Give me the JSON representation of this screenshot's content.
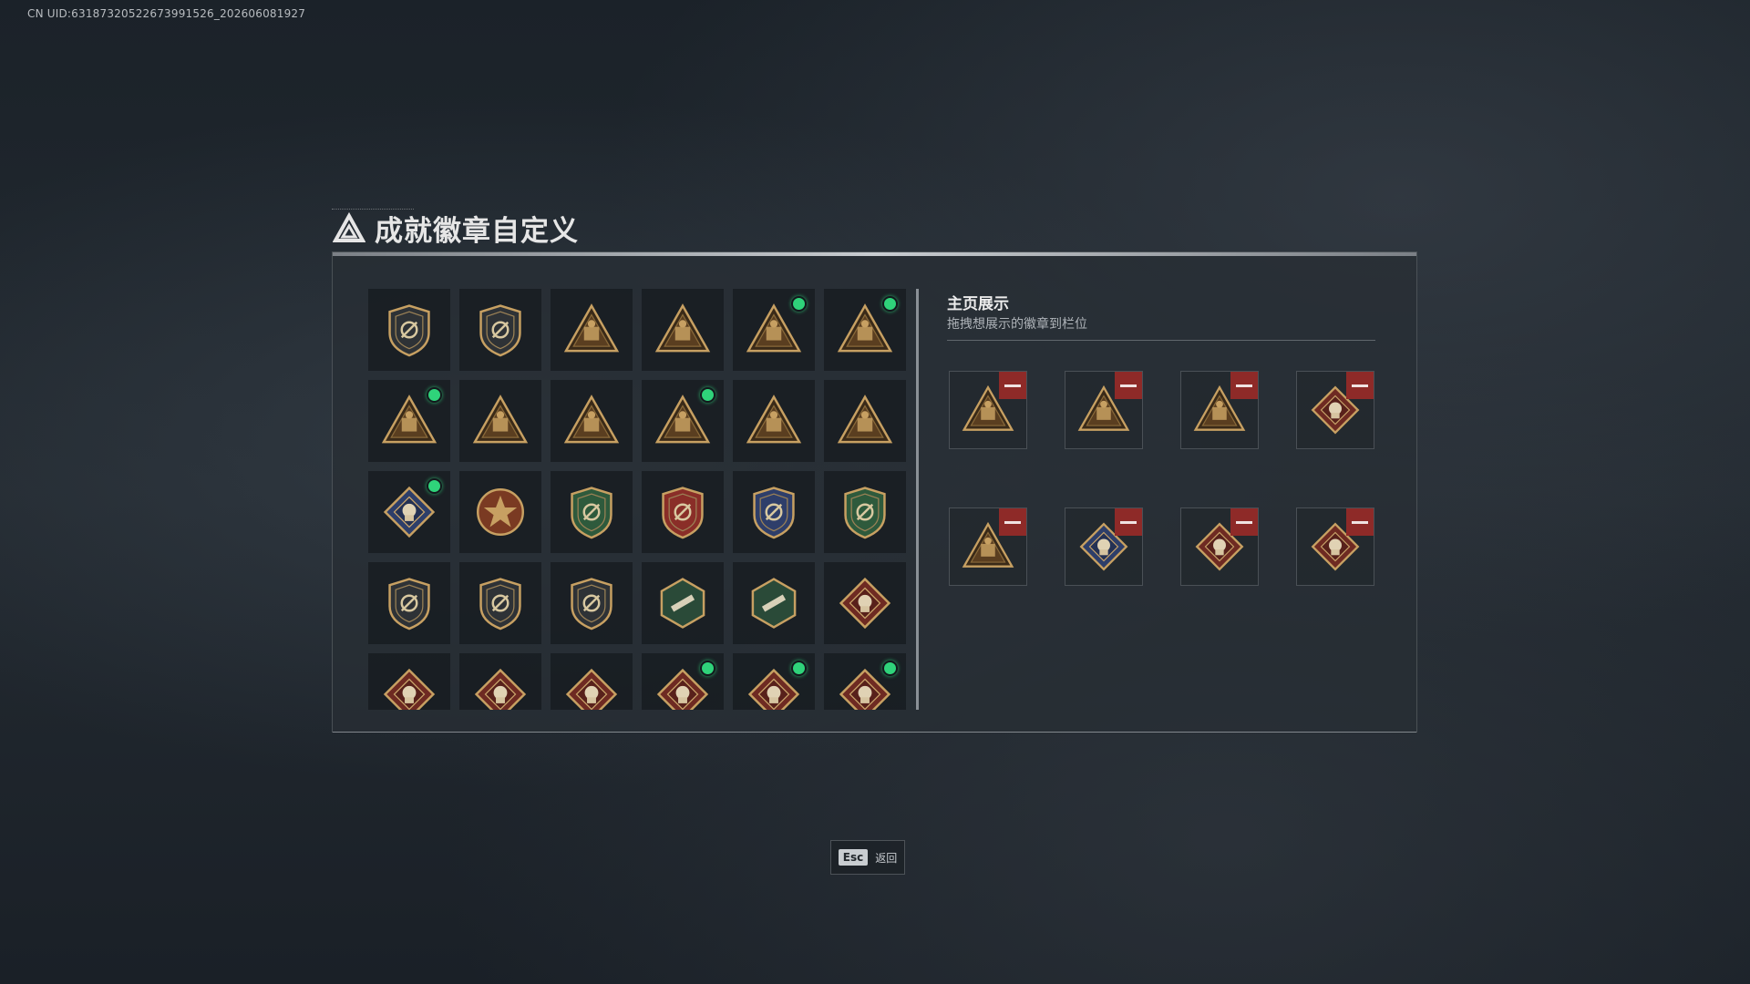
{
  "uid_text": "CN UID:6318732052267399​1526_202606081927",
  "title": "成就徽章自定义",
  "showcase": {
    "title": "主页展示",
    "subtitle": "拖拽想展示的徽章到栏位"
  },
  "esc": {
    "key": "Esc",
    "label": "返回"
  },
  "colors": {
    "new_dot": "#2fd37a",
    "remove": "#8e2a28",
    "gold": "#c7a062",
    "dark_red": "#6e2a22"
  },
  "badges": [
    {
      "id": "b1",
      "icon": "shield-delta-icon",
      "new": false
    },
    {
      "id": "b2",
      "icon": "shield-helicopter-icon",
      "new": false
    },
    {
      "id": "b3",
      "icon": "triangle-map-icon",
      "new": false
    },
    {
      "id": "b4",
      "icon": "triangle-bag-55-icon",
      "new": false
    },
    {
      "id": "b5",
      "icon": "triangle-gate-icon",
      "new": true
    },
    {
      "id": "b6",
      "icon": "triangle-58-icon",
      "new": true
    },
    {
      "id": "b7",
      "icon": "triangle-winged-icon",
      "new": true
    },
    {
      "id": "b8",
      "icon": "triangle-hands-icon",
      "new": false
    },
    {
      "id": "b9",
      "icon": "triangle-number-1-icon",
      "new": false
    },
    {
      "id": "b10",
      "icon": "triangle-crate-icon",
      "new": true
    },
    {
      "id": "b11",
      "icon": "triangle-beast-icon",
      "new": false
    },
    {
      "id": "b12",
      "icon": "triangle-soldiers-icon",
      "new": false
    },
    {
      "id": "b13",
      "icon": "diamond-crystal-icon",
      "new": true
    },
    {
      "id": "b14",
      "icon": "medal-star-icon",
      "new": false
    },
    {
      "id": "b15",
      "icon": "shield-green-icon",
      "new": false
    },
    {
      "id": "b16",
      "icon": "shield-red-stars-icon",
      "new": false
    },
    {
      "id": "b17",
      "icon": "shield-blue-icon",
      "new": false
    },
    {
      "id": "b18",
      "icon": "shield-green-crosshair-icon",
      "new": false
    },
    {
      "id": "b19",
      "icon": "shield-rifle-icon",
      "new": false
    },
    {
      "id": "b20",
      "icon": "shield-rifle-alt-icon",
      "new": false
    },
    {
      "id": "b21",
      "icon": "shield-crossed-guns-icon",
      "new": false
    },
    {
      "id": "b22",
      "icon": "hexagon-green-rifle-icon",
      "new": false
    },
    {
      "id": "b23",
      "icon": "hexagon-green-weapon-icon",
      "new": false
    },
    {
      "id": "b24",
      "icon": "diamond-dragon-icon",
      "new": false
    },
    {
      "id": "b25",
      "icon": "diamond-dragon-alt-icon",
      "new": false
    },
    {
      "id": "b26",
      "icon": "diamond-hammer-icon",
      "new": false
    },
    {
      "id": "b27",
      "icon": "diamond-wheel-icon",
      "new": false
    },
    {
      "id": "b28",
      "icon": "diamond-horse-icon",
      "new": true
    },
    {
      "id": "b29",
      "icon": "diamond-horse-alt-icon",
      "new": true
    },
    {
      "id": "b30",
      "icon": "diamond-wrench-icon",
      "new": true
    }
  ],
  "slots": [
    {
      "icon": "triangle-winged-icon"
    },
    {
      "icon": "triangle-gate-icon"
    },
    {
      "icon": "triangle-58-icon"
    },
    {
      "icon": "diamond-wrench-icon"
    },
    {
      "icon": "triangle-crate-icon"
    },
    {
      "icon": "diamond-crystal-icon"
    },
    {
      "icon": "diamond-horse-icon"
    },
    {
      "icon": "diamond-horse-alt-icon"
    }
  ]
}
